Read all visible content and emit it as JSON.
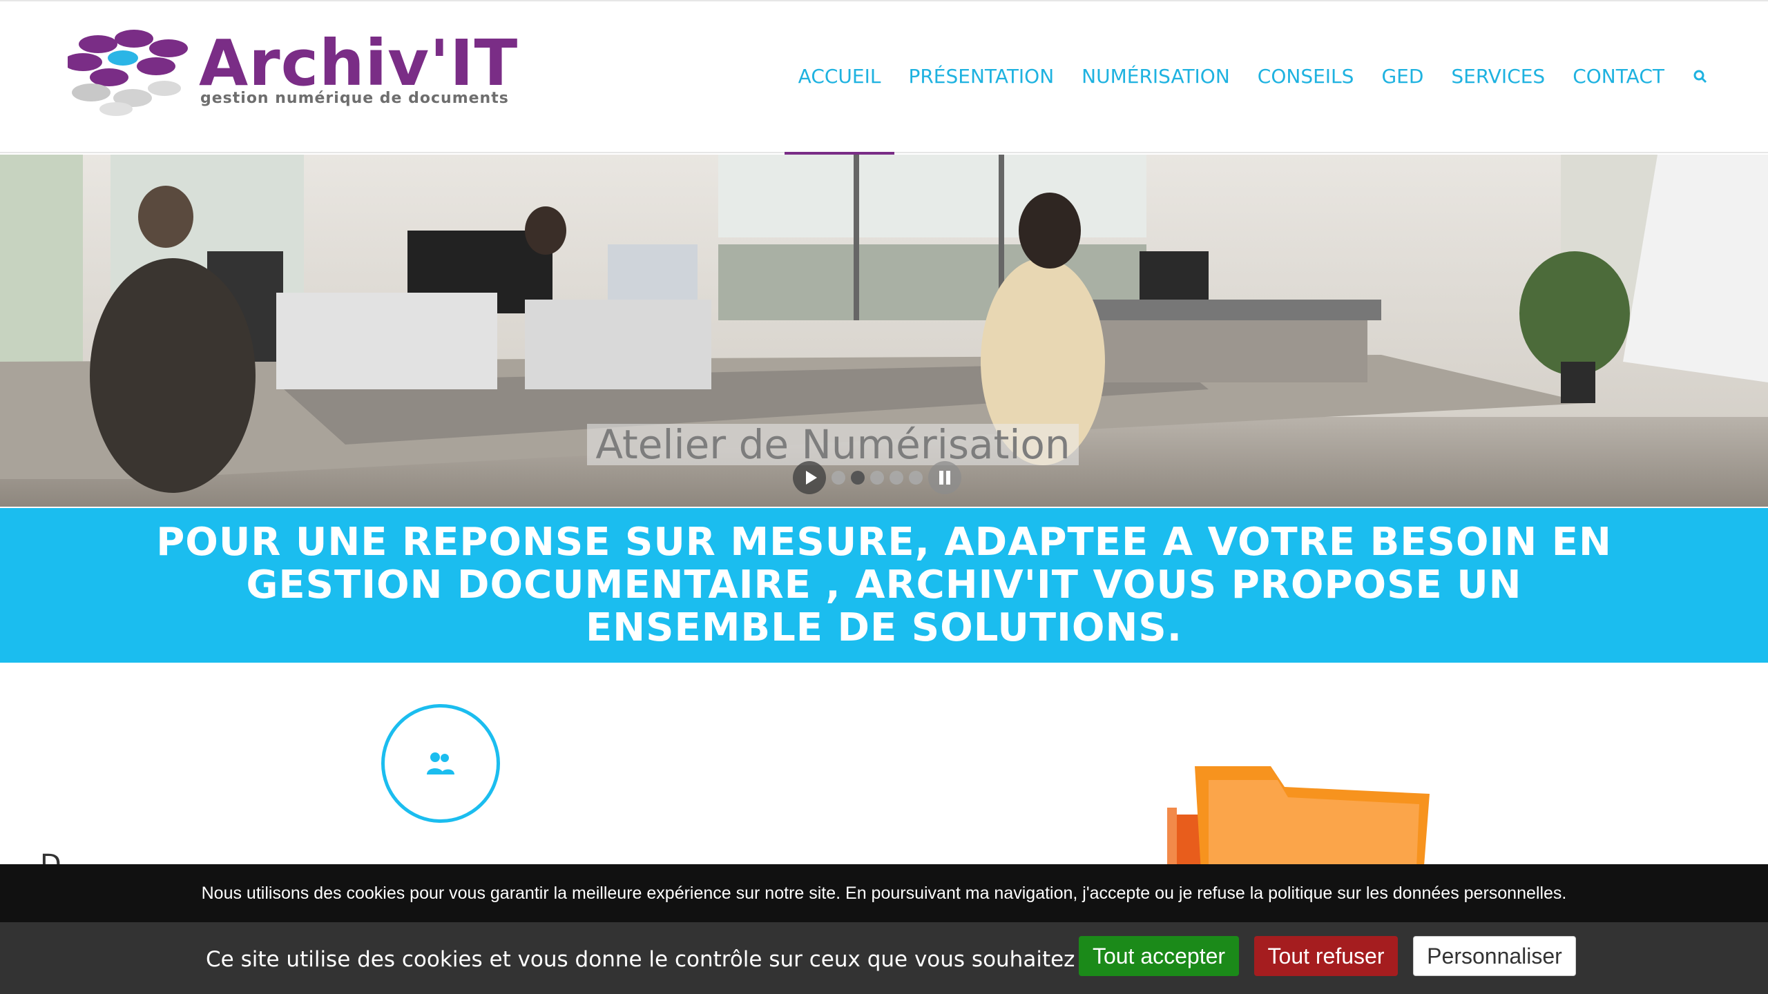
{
  "header": {
    "logo": {
      "wordmark": "Archiv'IT",
      "tagline": "gestion numérique de documents"
    },
    "nav": [
      {
        "label": "ACCUEIL",
        "active": true
      },
      {
        "label": "PRÉSENTATION",
        "active": false
      },
      {
        "label": "NUMÉRISATION",
        "active": false
      },
      {
        "label": "CONSEILS",
        "active": false
      },
      {
        "label": "GED",
        "active": false
      },
      {
        "label": "SERVICES",
        "active": false
      },
      {
        "label": "CONTACT",
        "active": false
      }
    ],
    "search_icon": "search-icon"
  },
  "hero": {
    "caption": "Atelier de Numérisation",
    "slides_count": 5,
    "active_slide": 2
  },
  "banner": {
    "text": "POUR UNE REPONSE SUR MESURE, ADAPTEE A VOTRE BESOIN EN GESTION DOCUMENTAIRE , ARCHIV'IT VOUS PROPOSE UN ENSEMBLE DE SOLUTIONS."
  },
  "content": {
    "icon": "users-icon",
    "intro_partial": "D"
  },
  "cookie": {
    "notice": "Nous utilisons des cookies pour vous garantir la meilleure expérience sur notre site. En poursuivant ma navigation, j'accepte ou je refuse la politique sur les données personnelles.",
    "control_text": "Ce site utilise des cookies et vous donne le contrôle sur ceux que vous souhaitez activer",
    "accept_label": "Tout accepter",
    "refuse_label": "Tout refuser",
    "customize_label": "Personnaliser"
  },
  "colors": {
    "brand_purple": "#7a2d86",
    "nav_blue": "#1eb2e0",
    "banner_blue": "#1bbdef",
    "accept_green": "#1b8a19",
    "refuse_red": "#a51d1f"
  }
}
